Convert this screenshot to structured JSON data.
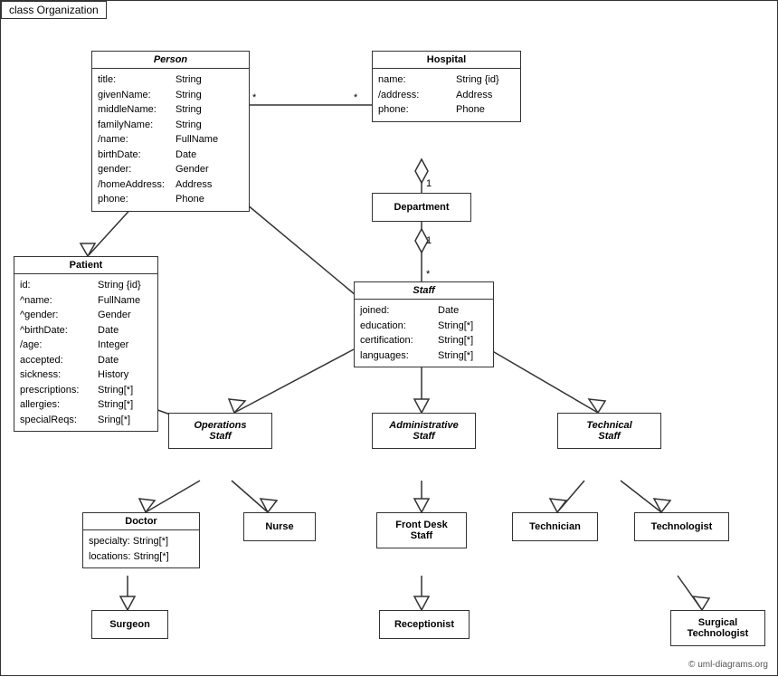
{
  "title": "class Organization",
  "classes": {
    "person": {
      "name": "Person",
      "italic": true,
      "attrs": [
        [
          "title:",
          "String"
        ],
        [
          "givenName:",
          "String"
        ],
        [
          "middleName:",
          "String"
        ],
        [
          "familyName:",
          "String"
        ],
        [
          "/name:",
          "FullName"
        ],
        [
          "birthDate:",
          "Date"
        ],
        [
          "gender:",
          "Gender"
        ],
        [
          "/homeAddress:",
          "Address"
        ],
        [
          "phone:",
          "Phone"
        ]
      ]
    },
    "hospital": {
      "name": "Hospital",
      "italic": false,
      "attrs": [
        [
          "name:",
          "String {id}"
        ],
        [
          "/address:",
          "Address"
        ],
        [
          "phone:",
          "Phone"
        ]
      ]
    },
    "patient": {
      "name": "Patient",
      "italic": false,
      "attrs": [
        [
          "id:",
          "String {id}"
        ],
        [
          "^name:",
          "FullName"
        ],
        [
          "^gender:",
          "Gender"
        ],
        [
          "^birthDate:",
          "Date"
        ],
        [
          "/age:",
          "Integer"
        ],
        [
          "accepted:",
          "Date"
        ],
        [
          "sickness:",
          "History"
        ],
        [
          "prescriptions:",
          "String[*]"
        ],
        [
          "allergies:",
          "String[*]"
        ],
        [
          "specialReqs:",
          "Sring[*]"
        ]
      ]
    },
    "department": {
      "name": "Department",
      "italic": false,
      "attrs": []
    },
    "staff": {
      "name": "Staff",
      "italic": true,
      "attrs": [
        [
          "joined:",
          "Date"
        ],
        [
          "education:",
          "String[*]"
        ],
        [
          "certification:",
          "String[*]"
        ],
        [
          "languages:",
          "String[*]"
        ]
      ]
    },
    "operations_staff": {
      "name": "Operations\nStaff",
      "italic": true,
      "attrs": []
    },
    "administrative_staff": {
      "name": "Administrative\nStaff",
      "italic": true,
      "attrs": []
    },
    "technical_staff": {
      "name": "Technical\nStaff",
      "italic": true,
      "attrs": []
    },
    "doctor": {
      "name": "Doctor",
      "italic": false,
      "attrs": [
        [
          "specialty:",
          "String[*]"
        ],
        [
          "locations:",
          "String[*]"
        ]
      ]
    },
    "nurse": {
      "name": "Nurse",
      "italic": false,
      "attrs": []
    },
    "front_desk_staff": {
      "name": "Front Desk\nStaff",
      "italic": false,
      "attrs": []
    },
    "technician": {
      "name": "Technician",
      "italic": false,
      "attrs": []
    },
    "technologist": {
      "name": "Technologist",
      "italic": false,
      "attrs": []
    },
    "surgeon": {
      "name": "Surgeon",
      "italic": false,
      "attrs": []
    },
    "receptionist": {
      "name": "Receptionist",
      "italic": false,
      "attrs": []
    },
    "surgical_technologist": {
      "name": "Surgical\nTechnologist",
      "italic": false,
      "attrs": []
    }
  },
  "copyright": "© uml-diagrams.org"
}
